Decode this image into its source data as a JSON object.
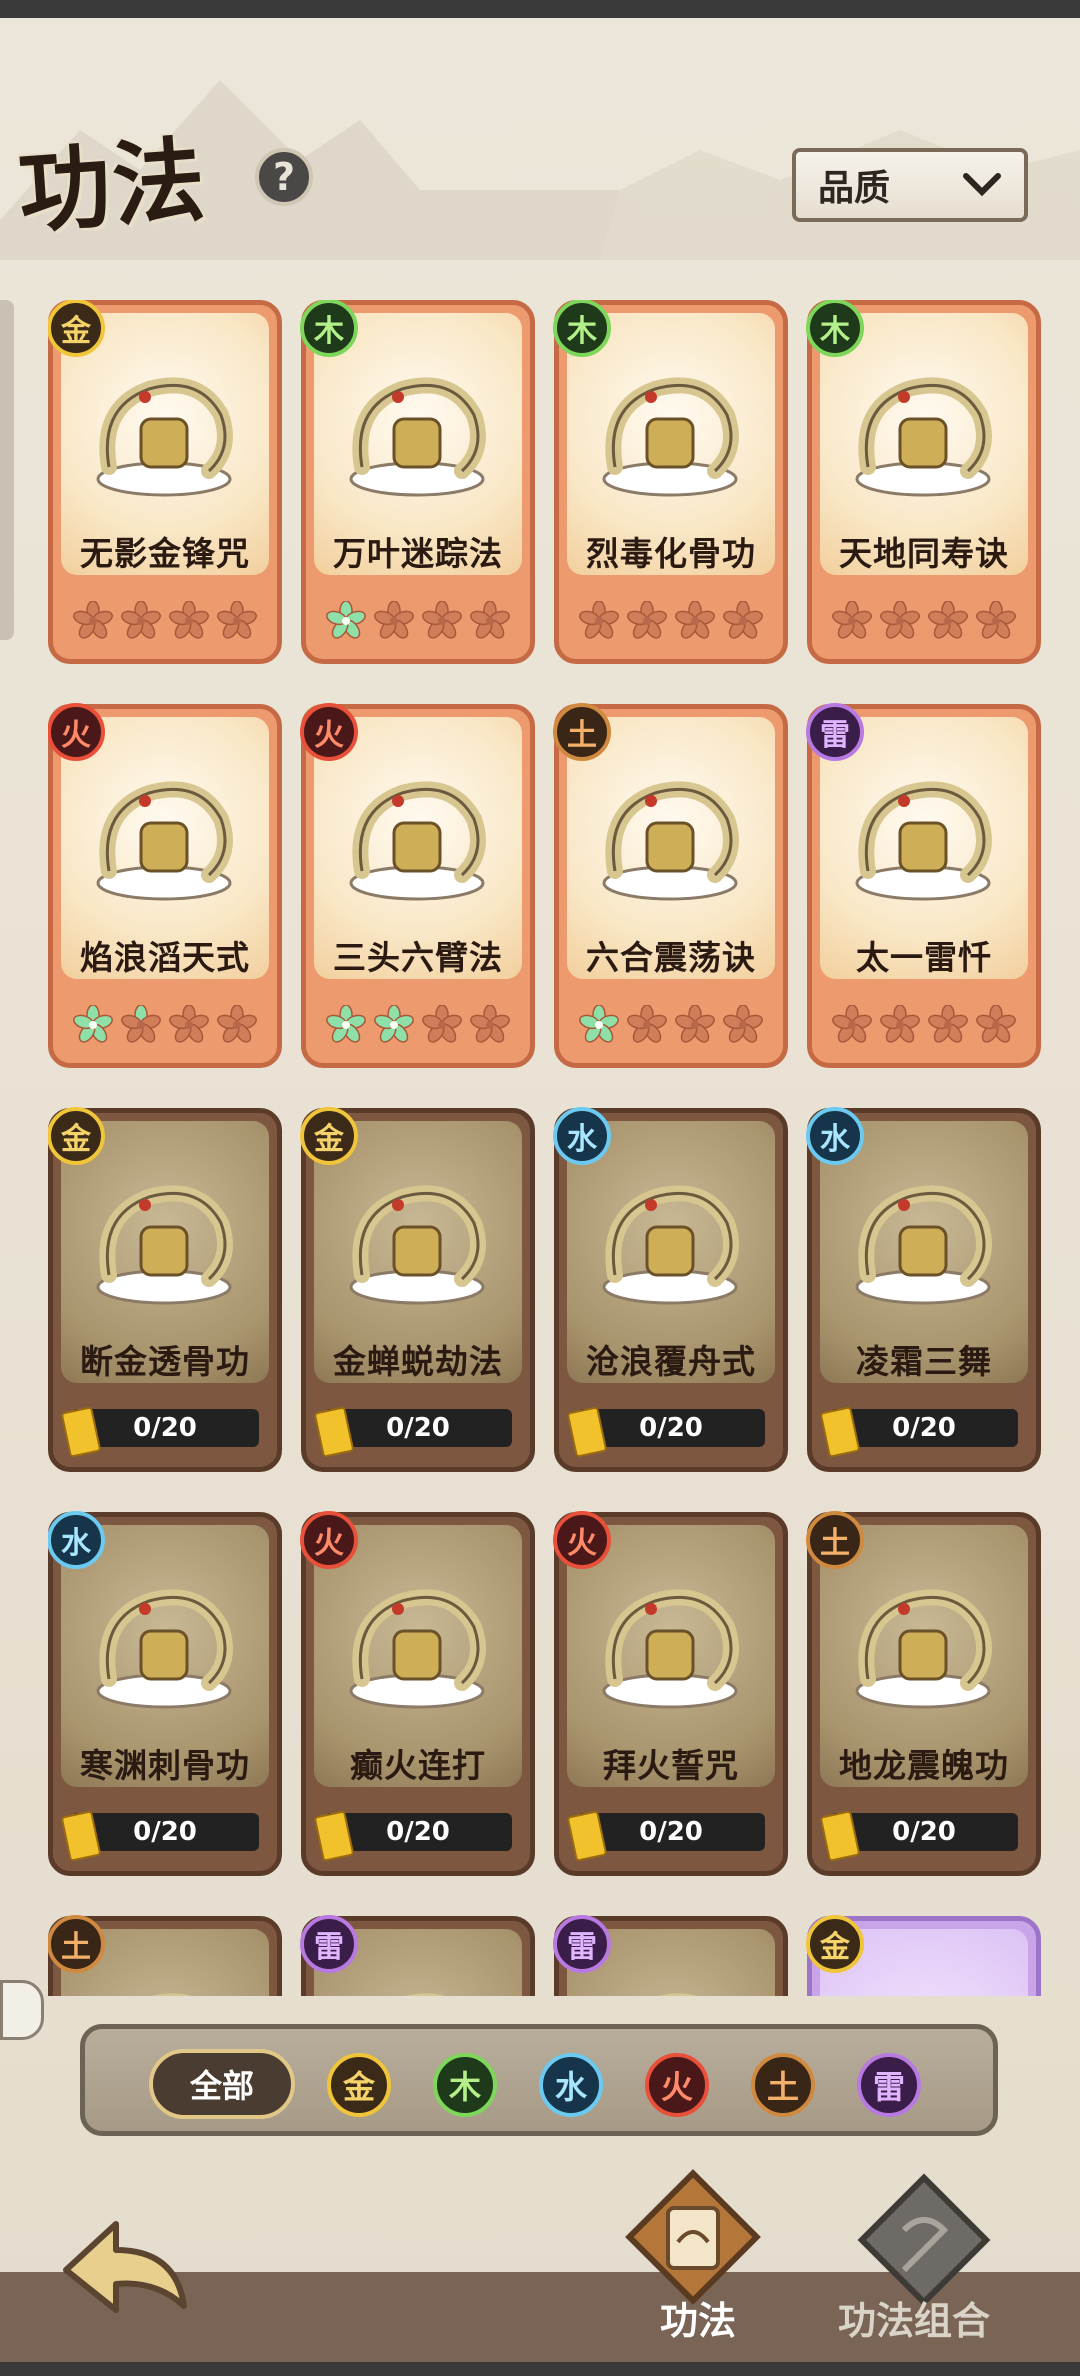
{
  "title": "功法",
  "help_icon": "question-icon",
  "quality_dropdown": {
    "label": "品质"
  },
  "element_colors": {
    "金": {
      "bg": "#3b2a18",
      "ring": "#f0c53a",
      "text": "#f5d36a"
    },
    "木": {
      "bg": "#1f3a1a",
      "ring": "#7ed65a",
      "text": "#b4f08a"
    },
    "水": {
      "bg": "#16344a",
      "ring": "#6ccaf0",
      "text": "#a8e6ff"
    },
    "火": {
      "bg": "#4a1818",
      "ring": "#e8503a",
      "text": "#ff8a6a"
    },
    "土": {
      "bg": "#3a2616",
      "ring": "#d08a40",
      "text": "#f2b06a"
    },
    "雷": {
      "bg": "#3a1d48",
      "ring": "#b87ae0",
      "text": "#e0b4ff"
    }
  },
  "cards": [
    {
      "name": "无影金锋咒",
      "element": "金",
      "state": "unlocked",
      "filled": 0
    },
    {
      "name": "万叶迷踪法",
      "element": "木",
      "state": "unlocked",
      "filled": 1
    },
    {
      "name": "烈毒化骨功",
      "element": "木",
      "state": "unlocked",
      "filled": 0
    },
    {
      "name": "天地同寿诀",
      "element": "木",
      "state": "unlocked",
      "filled": 0
    },
    {
      "name": "焰浪滔天式",
      "element": "火",
      "state": "unlocked",
      "filled": 1.5
    },
    {
      "name": "三头六臂法",
      "element": "火",
      "state": "unlocked",
      "filled": 2
    },
    {
      "name": "六合震荡诀",
      "element": "土",
      "state": "unlocked",
      "filled": 1
    },
    {
      "name": "太一雷忏",
      "element": "雷",
      "state": "unlocked",
      "filled": 0
    },
    {
      "name": "断金透骨功",
      "element": "金",
      "state": "locked",
      "progress": "0/20"
    },
    {
      "name": "金蝉蜕劫法",
      "element": "金",
      "state": "locked",
      "progress": "0/20"
    },
    {
      "name": "沧浪覆舟式",
      "element": "水",
      "state": "locked",
      "progress": "0/20"
    },
    {
      "name": "凌霜三舞",
      "element": "水",
      "state": "locked",
      "progress": "0/20"
    },
    {
      "name": "寒渊刺骨功",
      "element": "水",
      "state": "locked",
      "progress": "0/20"
    },
    {
      "name": "癫火连打",
      "element": "火",
      "state": "locked",
      "progress": "0/20"
    },
    {
      "name": "拜火誓咒",
      "element": "火",
      "state": "locked",
      "progress": "0/20"
    },
    {
      "name": "地龙震魄功",
      "element": "土",
      "state": "locked",
      "progress": "0/20"
    },
    {
      "name": "",
      "element": "土",
      "state": "locked"
    },
    {
      "name": "",
      "element": "雷",
      "state": "locked"
    },
    {
      "name": "",
      "element": "雷",
      "state": "locked"
    },
    {
      "name": "",
      "element": "金",
      "state": "purple"
    }
  ],
  "filter": {
    "all_label": "全部",
    "elements": [
      "金",
      "木",
      "水",
      "火",
      "土",
      "雷"
    ]
  },
  "nav": {
    "back_icon": "back-arrow-icon",
    "tab_gongfa": "功法",
    "tab_combo": "功法组合"
  }
}
